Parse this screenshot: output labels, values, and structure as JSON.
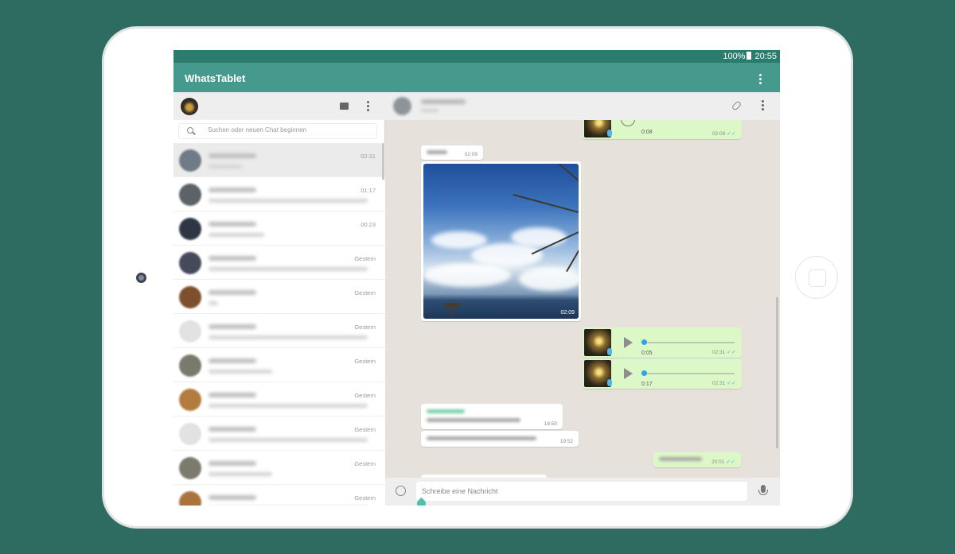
{
  "status_bar": {
    "battery": "100%",
    "time": "20:55"
  },
  "app": {
    "title": "WhatsTablet"
  },
  "search": {
    "placeholder": "Suchen oder neuen Chat beginnen"
  },
  "chats": [
    {
      "time": "02:31",
      "avatar": "#6f7b86",
      "msg_width": 42,
      "active": true
    },
    {
      "time": "01:17",
      "avatar": "#5d6266",
      "msg_width": 200
    },
    {
      "time": "00:23",
      "avatar": "#2e3643",
      "msg_width": 70
    },
    {
      "time": "Gestern",
      "avatar": "#454a5a",
      "msg_width": 200
    },
    {
      "time": "Gestern",
      "avatar": "#7d4f2c",
      "msg_width": 12
    },
    {
      "time": "Gestern",
      "avatar": "#e2e2e2",
      "msg_width": 200
    },
    {
      "time": "Gestern",
      "avatar": "#7a7a6c",
      "msg_width": 80
    },
    {
      "time": "Gestern",
      "avatar": "#b27b3f",
      "msg_width": 200
    },
    {
      "time": "Gestern",
      "avatar": "#e2e2e2",
      "msg_width": 200
    },
    {
      "time": "Gestern",
      "avatar": "#7b7a6d",
      "msg_width": 80
    },
    {
      "time": "Gestern",
      "avatar": "#a8733d",
      "msg_width": 200
    }
  ],
  "messages": {
    "voice_top": {
      "duration": "0:08",
      "time": "02:08"
    },
    "text_in_1": {
      "time": "02:09"
    },
    "photo": {
      "time": "02:09"
    },
    "voice_1": {
      "duration": "0:05",
      "time": "02:31"
    },
    "voice_2": {
      "duration": "0:17",
      "time": "02:31"
    },
    "text_in_2": {
      "time": "18:50"
    },
    "text_in_3": {
      "time": "19:52"
    },
    "text_out": {
      "time": "20:01"
    }
  },
  "compose": {
    "placeholder": "Schreibe eine Nachricht"
  },
  "colors": {
    "accent": "#459a8d",
    "status_bar": "#2b7c6e",
    "background": "#2e6b61",
    "out_bubble": "#dcf8c6",
    "chat_bg": "#e6e1da"
  }
}
